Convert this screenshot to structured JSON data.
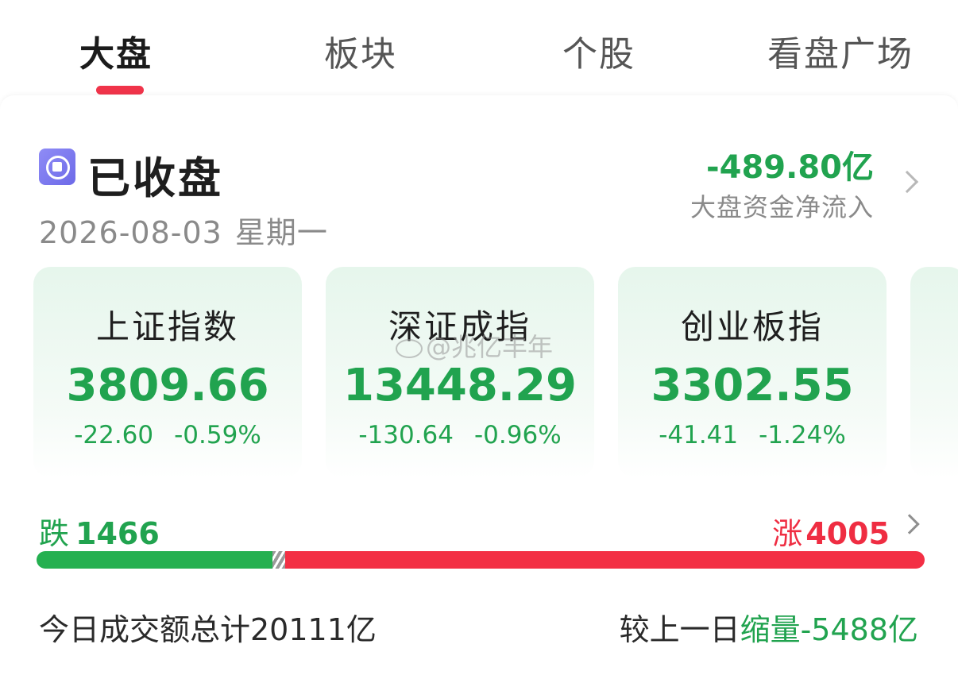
{
  "tabs": [
    {
      "label": "大盘",
      "active": true
    },
    {
      "label": "板块",
      "active": false
    },
    {
      "label": "个股",
      "active": false
    },
    {
      "label": "看盘广场",
      "active": false
    }
  ],
  "status": {
    "icon": "stop-circle-icon",
    "text": "已收盘",
    "date": "2026-08-03",
    "weekday": "星期一"
  },
  "capital_flow": {
    "value": "-489.80亿",
    "label": "大盘资金净流入"
  },
  "indices": [
    {
      "name": "上证指数",
      "value": "3809.66",
      "change": "-22.60",
      "change_pct": "-0.59%"
    },
    {
      "name": "深证成指",
      "value": "13448.29",
      "change": "-130.64",
      "change_pct": "-0.96%"
    },
    {
      "name": "创业板指",
      "value": "3302.55",
      "change": "-41.41",
      "change_pct": "-1.24%"
    }
  ],
  "watermark": "@兆亿丰年",
  "breadth": {
    "fall_label": "跌",
    "fall_count": "1466",
    "rise_label": "涨",
    "rise_count": "4005",
    "fall_fraction": 0.266,
    "flat_fraction": 0.014,
    "rise_fraction": 0.72
  },
  "turnover": {
    "total": "今日成交额总计20111亿",
    "compare_prefix": "较上一日",
    "compare_value": "缩量-5488亿"
  },
  "colors": {
    "down": "#21a34f",
    "up": "#ef2d42",
    "tab_indicator": "#f0344a",
    "status_icon": "#7b78ee"
  }
}
